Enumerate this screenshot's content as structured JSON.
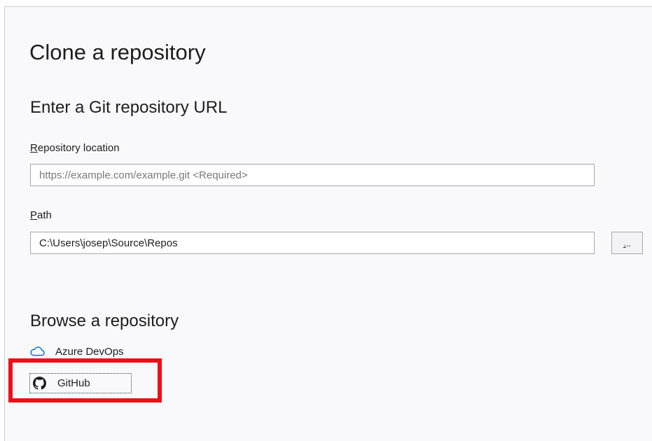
{
  "page": {
    "title": "Clone a repository"
  },
  "clone_url": {
    "section_title": "Enter a Git repository URL",
    "repository_location": {
      "label_accesskey": "R",
      "label_rest": "epository location",
      "value": "",
      "placeholder": "https://example.com/example.git <Required>"
    },
    "path": {
      "label_accesskey": "P",
      "label_rest": "ath",
      "value": "C:\\Users\\josep\\Source\\Repos"
    },
    "browse_button": {
      "accesskey": ".",
      "rest": ".."
    }
  },
  "browse": {
    "section_title": "Browse a repository",
    "providers": [
      {
        "label": "Azure DevOps",
        "icon": "cloud-icon",
        "color": "#0078d4"
      },
      {
        "label": "GitHub",
        "icon": "github-icon",
        "color": "#1e1e1e"
      }
    ]
  },
  "annotation": {
    "highlight_color": "#ee0d18"
  }
}
